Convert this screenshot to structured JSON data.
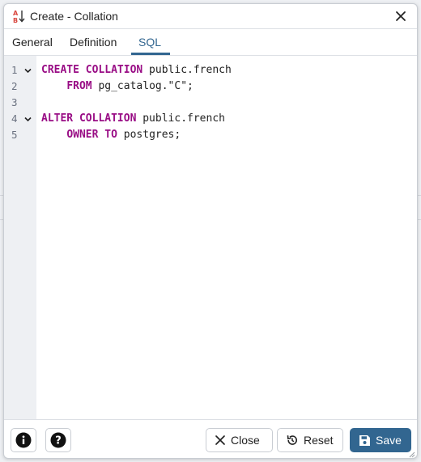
{
  "dialog": {
    "title": "Create - Collation",
    "title_icon": "collation-icon",
    "close_icon": "close-icon"
  },
  "tabs": [
    {
      "label": "General",
      "active": false
    },
    {
      "label": "Definition",
      "active": false
    },
    {
      "label": "SQL",
      "active": true
    }
  ],
  "editor": {
    "lines": [
      {
        "num": "1",
        "fold": true,
        "tokens": [
          {
            "t": "CREATE COLLATION",
            "kw": true
          },
          {
            "t": " public.french",
            "kw": false
          }
        ]
      },
      {
        "num": "2",
        "fold": false,
        "tokens": [
          {
            "t": "    ",
            "kw": false
          },
          {
            "t": "FROM",
            "kw": true
          },
          {
            "t": " pg_catalog.\"C\";",
            "kw": false
          }
        ]
      },
      {
        "num": "3",
        "fold": false,
        "tokens": []
      },
      {
        "num": "4",
        "fold": true,
        "tokens": [
          {
            "t": "ALTER COLLATION",
            "kw": true
          },
          {
            "t": " public.french",
            "kw": false
          }
        ]
      },
      {
        "num": "5",
        "fold": false,
        "tokens": [
          {
            "t": "    ",
            "kw": false
          },
          {
            "t": "OWNER TO",
            "kw": true
          },
          {
            "t": " postgres;",
            "kw": false
          }
        ]
      }
    ]
  },
  "footer": {
    "info_icon": "info-icon",
    "help_icon": "help-icon",
    "close_label": "Close",
    "reset_label": "Reset",
    "save_label": "Save"
  },
  "colors": {
    "accent": "#326690",
    "keyword": "#990d85"
  }
}
